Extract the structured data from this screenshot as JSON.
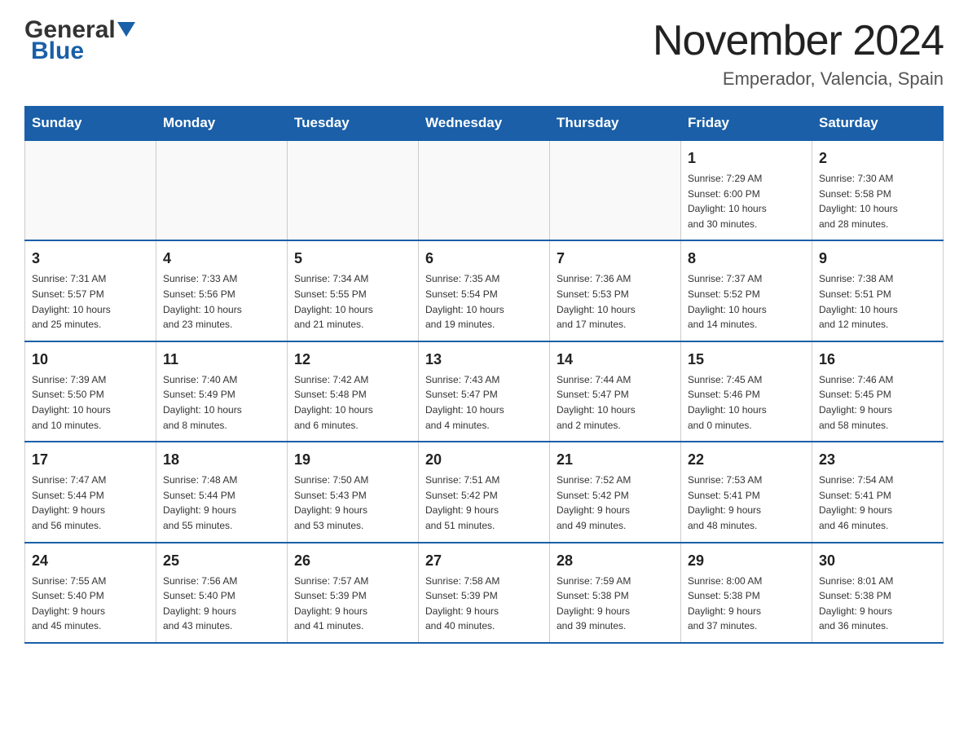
{
  "header": {
    "month_title": "November 2024",
    "location": "Emperador, Valencia, Spain",
    "logo_general": "General",
    "logo_blue": "Blue"
  },
  "days_of_week": [
    "Sunday",
    "Monday",
    "Tuesday",
    "Wednesday",
    "Thursday",
    "Friday",
    "Saturday"
  ],
  "weeks": [
    [
      {
        "day": "",
        "info": ""
      },
      {
        "day": "",
        "info": ""
      },
      {
        "day": "",
        "info": ""
      },
      {
        "day": "",
        "info": ""
      },
      {
        "day": "",
        "info": ""
      },
      {
        "day": "1",
        "info": "Sunrise: 7:29 AM\nSunset: 6:00 PM\nDaylight: 10 hours\nand 30 minutes."
      },
      {
        "day": "2",
        "info": "Sunrise: 7:30 AM\nSunset: 5:58 PM\nDaylight: 10 hours\nand 28 minutes."
      }
    ],
    [
      {
        "day": "3",
        "info": "Sunrise: 7:31 AM\nSunset: 5:57 PM\nDaylight: 10 hours\nand 25 minutes."
      },
      {
        "day": "4",
        "info": "Sunrise: 7:33 AM\nSunset: 5:56 PM\nDaylight: 10 hours\nand 23 minutes."
      },
      {
        "day": "5",
        "info": "Sunrise: 7:34 AM\nSunset: 5:55 PM\nDaylight: 10 hours\nand 21 minutes."
      },
      {
        "day": "6",
        "info": "Sunrise: 7:35 AM\nSunset: 5:54 PM\nDaylight: 10 hours\nand 19 minutes."
      },
      {
        "day": "7",
        "info": "Sunrise: 7:36 AM\nSunset: 5:53 PM\nDaylight: 10 hours\nand 17 minutes."
      },
      {
        "day": "8",
        "info": "Sunrise: 7:37 AM\nSunset: 5:52 PM\nDaylight: 10 hours\nand 14 minutes."
      },
      {
        "day": "9",
        "info": "Sunrise: 7:38 AM\nSunset: 5:51 PM\nDaylight: 10 hours\nand 12 minutes."
      }
    ],
    [
      {
        "day": "10",
        "info": "Sunrise: 7:39 AM\nSunset: 5:50 PM\nDaylight: 10 hours\nand 10 minutes."
      },
      {
        "day": "11",
        "info": "Sunrise: 7:40 AM\nSunset: 5:49 PM\nDaylight: 10 hours\nand 8 minutes."
      },
      {
        "day": "12",
        "info": "Sunrise: 7:42 AM\nSunset: 5:48 PM\nDaylight: 10 hours\nand 6 minutes."
      },
      {
        "day": "13",
        "info": "Sunrise: 7:43 AM\nSunset: 5:47 PM\nDaylight: 10 hours\nand 4 minutes."
      },
      {
        "day": "14",
        "info": "Sunrise: 7:44 AM\nSunset: 5:47 PM\nDaylight: 10 hours\nand 2 minutes."
      },
      {
        "day": "15",
        "info": "Sunrise: 7:45 AM\nSunset: 5:46 PM\nDaylight: 10 hours\nand 0 minutes."
      },
      {
        "day": "16",
        "info": "Sunrise: 7:46 AM\nSunset: 5:45 PM\nDaylight: 9 hours\nand 58 minutes."
      }
    ],
    [
      {
        "day": "17",
        "info": "Sunrise: 7:47 AM\nSunset: 5:44 PM\nDaylight: 9 hours\nand 56 minutes."
      },
      {
        "day": "18",
        "info": "Sunrise: 7:48 AM\nSunset: 5:44 PM\nDaylight: 9 hours\nand 55 minutes."
      },
      {
        "day": "19",
        "info": "Sunrise: 7:50 AM\nSunset: 5:43 PM\nDaylight: 9 hours\nand 53 minutes."
      },
      {
        "day": "20",
        "info": "Sunrise: 7:51 AM\nSunset: 5:42 PM\nDaylight: 9 hours\nand 51 minutes."
      },
      {
        "day": "21",
        "info": "Sunrise: 7:52 AM\nSunset: 5:42 PM\nDaylight: 9 hours\nand 49 minutes."
      },
      {
        "day": "22",
        "info": "Sunrise: 7:53 AM\nSunset: 5:41 PM\nDaylight: 9 hours\nand 48 minutes."
      },
      {
        "day": "23",
        "info": "Sunrise: 7:54 AM\nSunset: 5:41 PM\nDaylight: 9 hours\nand 46 minutes."
      }
    ],
    [
      {
        "day": "24",
        "info": "Sunrise: 7:55 AM\nSunset: 5:40 PM\nDaylight: 9 hours\nand 45 minutes."
      },
      {
        "day": "25",
        "info": "Sunrise: 7:56 AM\nSunset: 5:40 PM\nDaylight: 9 hours\nand 43 minutes."
      },
      {
        "day": "26",
        "info": "Sunrise: 7:57 AM\nSunset: 5:39 PM\nDaylight: 9 hours\nand 41 minutes."
      },
      {
        "day": "27",
        "info": "Sunrise: 7:58 AM\nSunset: 5:39 PM\nDaylight: 9 hours\nand 40 minutes."
      },
      {
        "day": "28",
        "info": "Sunrise: 7:59 AM\nSunset: 5:38 PM\nDaylight: 9 hours\nand 39 minutes."
      },
      {
        "day": "29",
        "info": "Sunrise: 8:00 AM\nSunset: 5:38 PM\nDaylight: 9 hours\nand 37 minutes."
      },
      {
        "day": "30",
        "info": "Sunrise: 8:01 AM\nSunset: 5:38 PM\nDaylight: 9 hours\nand 36 minutes."
      }
    ]
  ]
}
